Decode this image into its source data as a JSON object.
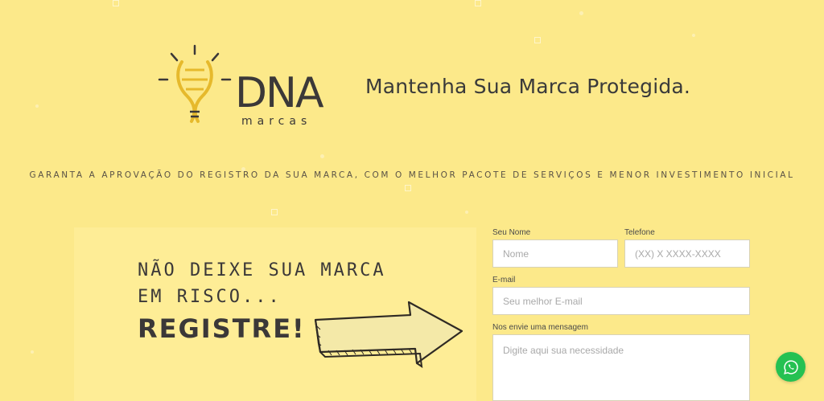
{
  "brand": {
    "name": "DNA",
    "sub": "marcas",
    "tagline": "Mantenha Sua Marca Protegida."
  },
  "subheading": "GARANTA A APROVAÇÃO DO REGISTRO DA SUA MARCA, COM O MELHOR PACOTE DE SERVIÇOS E MENOR INVESTIMENTO INICIAL",
  "hero": {
    "line1": "NÃO DEIXE SUA MARCA",
    "line2": "EM RISCO...",
    "cta": "REGISTRE!"
  },
  "form": {
    "name_label": "Seu Nome",
    "name_placeholder": "Nome",
    "phone_label": "Telefone",
    "phone_placeholder": "(XX) X XXXX-XXXX",
    "email_label": "E-mail",
    "email_placeholder": "Seu melhor E-mail",
    "message_label": "Nos envie uma mensagem",
    "message_placeholder": "Digite aqui sua necessidade"
  },
  "colors": {
    "background": "#fce98a",
    "logo_gold": "#e6b92c",
    "text_dark": "#3b3838",
    "whatsapp": "#25c152"
  }
}
